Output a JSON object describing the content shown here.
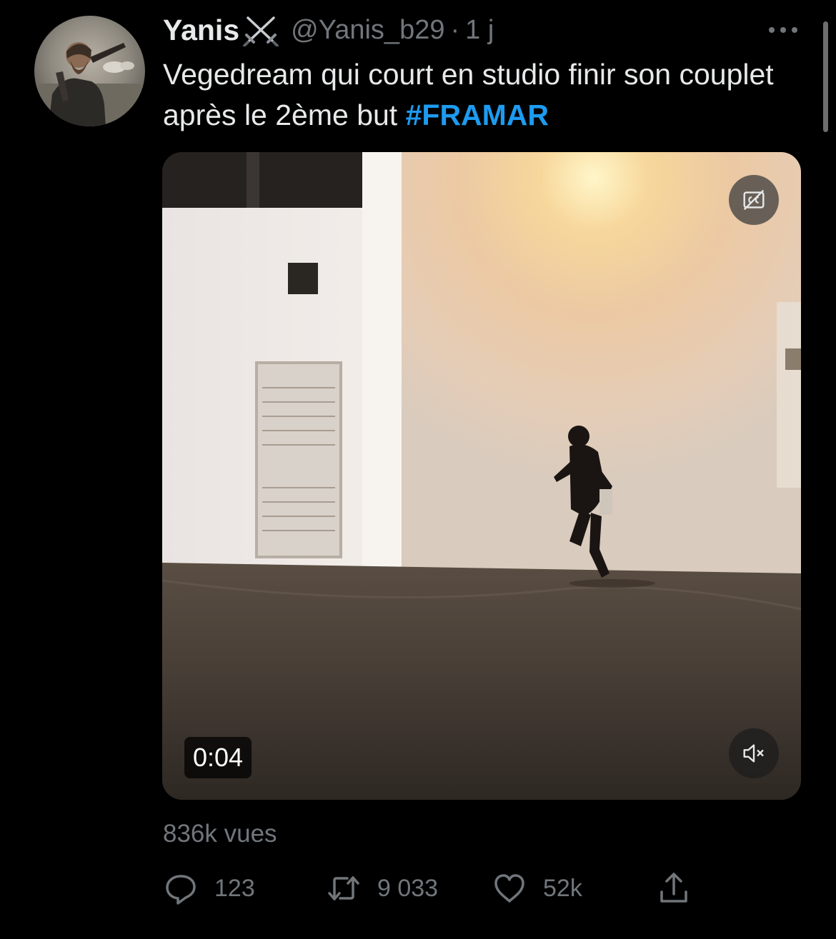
{
  "tweet": {
    "display_name": "Yanis",
    "handle": "@Yanis_b29",
    "separator": "·",
    "time": "1 j",
    "text_main": "Vegedream qui court en studio finir son couplet après le 2ème but ",
    "hashtag": "#FRAMAR",
    "hashtag_color": "#1d9bf0"
  },
  "video": {
    "duration": "0:04"
  },
  "stats": {
    "views": "836k vues",
    "replies": "123",
    "retweets": "9 033",
    "likes": "52k"
  },
  "icons": {
    "name_emoji": "crossed-swords-icon",
    "more": "more-icon",
    "captions": "captions-off-icon",
    "mute": "muted-speaker-icon",
    "reply": "reply-icon",
    "retweet": "retweet-icon",
    "like": "heart-icon",
    "share": "share-icon"
  }
}
